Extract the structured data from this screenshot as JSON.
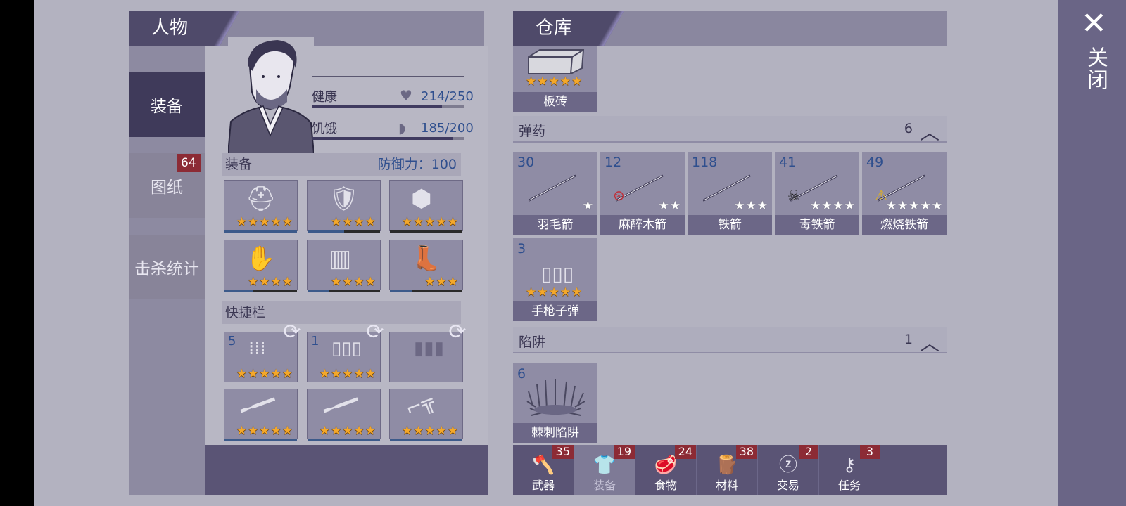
{
  "character_panel": {
    "title": "人物",
    "tabs": [
      {
        "label": "装备",
        "active": true
      },
      {
        "label": "图纸",
        "badge": "64"
      },
      {
        "label": "击杀统计"
      }
    ],
    "stats": {
      "health_label": "健康",
      "health_value": "214/250",
      "health_ratio": 0.856,
      "hunger_label": "饥饿",
      "hunger_value": "185/200",
      "hunger_ratio": 0.925
    },
    "equipment": {
      "label": "装备",
      "defense_label": "防御力：100",
      "slots": [
        {
          "icon": "helmet-icon",
          "stars": 5,
          "durability": 1.0
        },
        {
          "icon": "body-armor-icon",
          "stars": 4,
          "durability": 0.5
        },
        {
          "icon": "shell-armor-icon",
          "stars": 5,
          "durability": 0.0
        },
        {
          "icon": "gloves-icon",
          "stars": 4,
          "durability": 0.4
        },
        {
          "icon": "pants-icon",
          "stars": 4,
          "durability": 0.3
        },
        {
          "icon": "boots-icon",
          "stars": 3,
          "durability": 0.3
        }
      ]
    },
    "hotbar": {
      "label": "快捷栏",
      "ammo_slots": [
        {
          "qty": "5",
          "icon": "rifle-bullets-icon",
          "stars": 5
        },
        {
          "qty": "1",
          "icon": "pistol-bullets-icon",
          "stars": 5
        },
        {
          "qty": "",
          "icon": "empty-bullets-icon",
          "stars": 0
        }
      ],
      "weapon_slots": [
        {
          "icon": "shotgun-icon",
          "stars": 5,
          "durability": 1.0
        },
        {
          "icon": "hunting-shotgun-icon",
          "stars": 5,
          "durability": 1.0
        },
        {
          "icon": "revolver-icon",
          "stars": 5,
          "durability": 1.0
        }
      ]
    }
  },
  "storage_panel": {
    "title": "仓库",
    "top_item": {
      "label": "板砖",
      "stars": 5,
      "icon": "brick-icon"
    },
    "categories": [
      {
        "name": "弹药",
        "count": "6",
        "items": [
          {
            "num": "30",
            "label": "羽毛箭",
            "stars": 1,
            "icon": "feather-arrow-icon"
          },
          {
            "num": "12",
            "label": "麻醉木箭",
            "stars": 2,
            "icon": "tranq-arrow-icon"
          },
          {
            "num": "118",
            "label": "铁箭",
            "stars": 3,
            "icon": "iron-arrow-icon"
          },
          {
            "num": "41",
            "label": "毒铁箭",
            "stars": 4,
            "icon": "poison-arrow-icon"
          },
          {
            "num": "49",
            "label": "燃烧铁箭",
            "stars": 5,
            "icon": "fire-arrow-icon"
          },
          {
            "num": "3",
            "label": "手枪子弹",
            "stars": 5,
            "icon": "pistol-bullets-icon"
          }
        ]
      },
      {
        "name": "陷阱",
        "count": "1",
        "items": [
          {
            "num": "6",
            "label": "棘刺陷阱",
            "icon": "spike-trap-icon"
          }
        ]
      }
    ],
    "bottom_tabs": [
      {
        "label": "武器",
        "badge": "35",
        "icon": "axe-icon"
      },
      {
        "label": "装备",
        "badge": "19",
        "icon": "shirt-icon",
        "active": true
      },
      {
        "label": "食物",
        "badge": "24",
        "icon": "meat-icon"
      },
      {
        "label": "材料",
        "badge": "38",
        "icon": "wood-icon"
      },
      {
        "label": "交易",
        "badge": "2",
        "icon": "coin-icon"
      },
      {
        "label": "任务",
        "badge": "3",
        "icon": "key-icon"
      }
    ]
  },
  "close": {
    "label": "关闭"
  },
  "colors": {
    "accent_dark": "#4f4a6a",
    "star_gold": "#f4a82a",
    "badge_red": "#8c2b35",
    "number_blue": "#2f4f8e"
  }
}
